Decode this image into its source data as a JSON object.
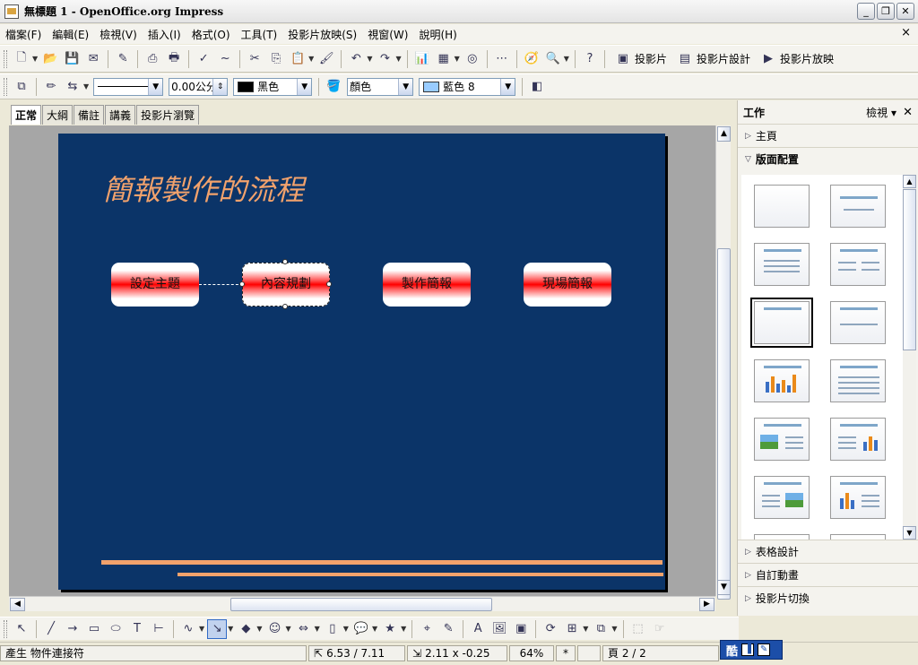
{
  "window": {
    "title": "無標題 1 - OpenOffice.org Impress",
    "close_doc": "×"
  },
  "menu": [
    "檔案(F)",
    "編輯(E)",
    "檢視(V)",
    "插入(I)",
    "格式(O)",
    "工具(T)",
    "投影片放映(S)",
    "視窗(W)",
    "說明(H)"
  ],
  "toolbar1": {
    "slide_label": "投影片",
    "slide_design_label": "投影片設計",
    "slideshow_label": "投影片放映"
  },
  "toolbar2": {
    "line_width": "0.00公分",
    "line_color": "黑色",
    "area_style": "顏色",
    "area_color": "藍色 8",
    "line_color_hex": "#000000",
    "area_color_hex": "#99ccff"
  },
  "view_tabs": [
    "正常",
    "大綱",
    "備註",
    "講義",
    "投影片瀏覽"
  ],
  "slide": {
    "title": "簡報製作的流程",
    "background": "#0b3468",
    "accent": "#f2a26c",
    "boxes": [
      "設定主題",
      "內容規劃",
      "製作簡報",
      "現場簡報"
    ]
  },
  "taskpane": {
    "title": "工作",
    "view": "檢視",
    "sections_top": [
      "主頁",
      "版面配置"
    ],
    "sections_bottom": [
      "表格設計",
      "自訂動畫",
      "投影片切換"
    ]
  },
  "statusbar": {
    "message": "產生 物件連接符",
    "position": "6.53 / 7.11",
    "size": "2.11 x -0.25",
    "zoom": "64%",
    "modified": "*",
    "page": "頁 2 / 2"
  },
  "ime": {
    "label": "酷"
  }
}
